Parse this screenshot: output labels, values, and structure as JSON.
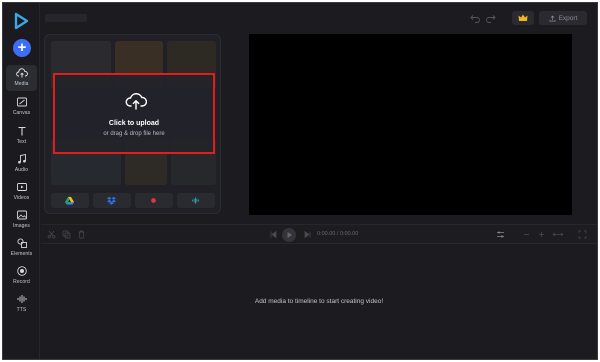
{
  "sidebar": {
    "items": [
      {
        "label": "Media",
        "icon": "cloud-upload-icon",
        "active": true
      },
      {
        "label": "Canvas",
        "icon": "canvas-icon"
      },
      {
        "label": "Text",
        "icon": "text-icon"
      },
      {
        "label": "Audio",
        "icon": "music-note-icon"
      },
      {
        "label": "Videos",
        "icon": "video-icon"
      },
      {
        "label": "Images",
        "icon": "image-icon"
      },
      {
        "label": "Elements",
        "icon": "shapes-icon"
      },
      {
        "label": "Record",
        "icon": "record-icon"
      },
      {
        "label": "TTS",
        "icon": "waveform-icon"
      }
    ]
  },
  "topbar": {
    "export_label": "Export"
  },
  "upload": {
    "title": "Click to upload",
    "subtitle": "or drag & drop file here"
  },
  "sources": [
    {
      "icon": "google-drive-icon"
    },
    {
      "icon": "dropbox-icon"
    },
    {
      "icon": "record-dot-icon"
    },
    {
      "icon": "audio-wave-icon"
    }
  ],
  "timeline": {
    "current_time": "0:00.00",
    "separator": "/",
    "total_time": "0:00.00",
    "empty_message": "Add media to timeline to start creating video!"
  },
  "colors": {
    "accent": "#3d6ef7",
    "highlight": "#e01e1e",
    "background": "#1b1b20"
  }
}
